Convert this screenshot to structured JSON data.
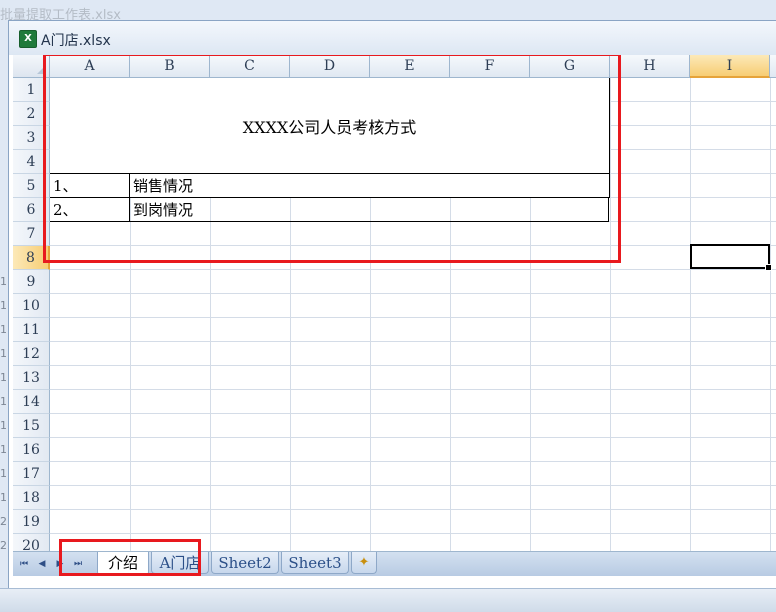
{
  "background_window": {
    "title": "批量提取工作表.xlsx",
    "row_numbers": [
      "1",
      "1",
      "1",
      "1",
      "1",
      "1",
      "1",
      "1",
      "1",
      "1",
      "2",
      "2"
    ]
  },
  "window": {
    "title": "A门店.xlsx",
    "app_icon_letter": "X"
  },
  "columns": [
    "A",
    "B",
    "C",
    "D",
    "E",
    "F",
    "G",
    "H",
    "I"
  ],
  "rows": [
    "1",
    "2",
    "3",
    "4",
    "5",
    "6",
    "7",
    "8",
    "9",
    "10",
    "11",
    "12",
    "13",
    "14",
    "15",
    "16",
    "17",
    "18",
    "19",
    "20"
  ],
  "active_cell": {
    "column": "I",
    "row": "8"
  },
  "sheet": {
    "title": "XXXX公司人员考核方式",
    "items": [
      {
        "num": "1、",
        "label": "销售情况"
      },
      {
        "num": "2、",
        "label": "到岗情况"
      }
    ]
  },
  "tabs": [
    {
      "label": "介绍",
      "active": true
    },
    {
      "label": "A门店",
      "active": false
    },
    {
      "label": "Sheet2",
      "active": false
    },
    {
      "label": "Sheet3",
      "active": false
    }
  ],
  "tab_nav": {
    "first": "⏮",
    "prev": "◀",
    "next": "▶",
    "last": "⏭"
  },
  "new_sheet_icon": "new-sheet-icon",
  "colors": {
    "highlight": "#e8191e",
    "active_header": "#f7cd74",
    "grid_line": "#d4dce7"
  }
}
